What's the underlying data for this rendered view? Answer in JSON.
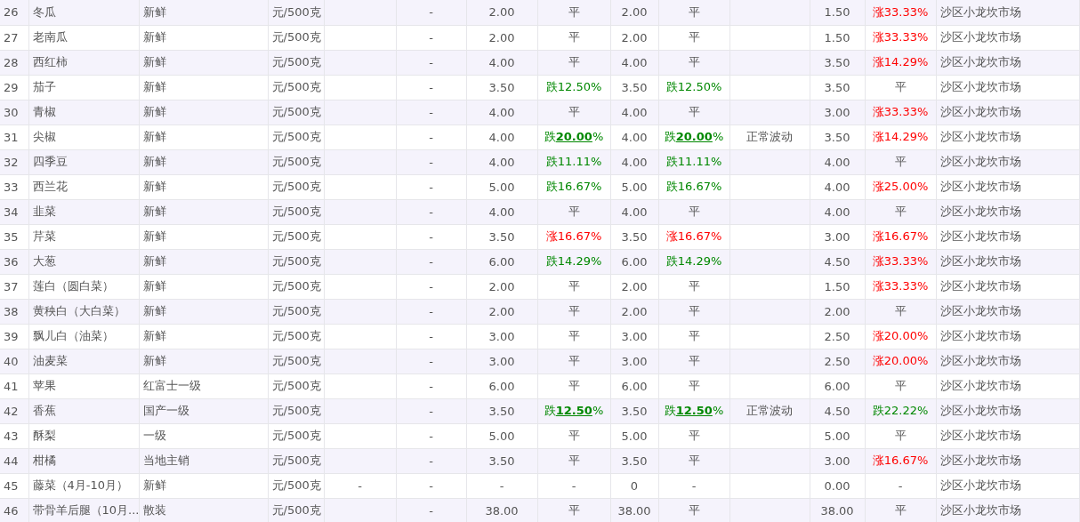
{
  "rows": [
    {
      "no": "26",
      "name": "冬瓜",
      "spec": "新鲜",
      "unit": "元/500克",
      "col5": "-",
      "price1": "2.00",
      "change1": {
        "text": "平"
      },
      "price2": "2.00",
      "change2": {
        "text": "平"
      },
      "price3": "1.50",
      "change3": {
        "text": "涨33.33%",
        "color": "#ff0000"
      },
      "market": "沙区小龙坎市场"
    },
    {
      "no": "27",
      "name": "老南瓜",
      "spec": "新鲜",
      "unit": "元/500克",
      "col5": "-",
      "price1": "2.00",
      "change1": {
        "text": "平"
      },
      "price2": "2.00",
      "change2": {
        "text": "平"
      },
      "price3": "1.50",
      "change3": {
        "text": "涨33.33%",
        "color": "#ff0000"
      },
      "market": "沙区小龙坎市场"
    },
    {
      "no": "28",
      "name": "西红柿",
      "spec": "新鲜",
      "unit": "元/500克",
      "col5": "-",
      "price1": "4.00",
      "change1": {
        "text": "平"
      },
      "price2": "4.00",
      "change2": {
        "text": "平"
      },
      "price3": "3.50",
      "change3": {
        "text": "涨14.29%",
        "color": "#ff0000"
      },
      "market": "沙区小龙坎市场"
    },
    {
      "no": "29",
      "name": "茄子",
      "spec": "新鲜",
      "unit": "元/500克",
      "col5": "-",
      "price1": "3.50",
      "change1": {
        "text": "跌12.50%",
        "color": "#008800"
      },
      "price2": "3.50",
      "change2": {
        "text": "跌12.50%",
        "color": "#008800"
      },
      "price3": "3.50",
      "change3": {
        "text": "平"
      },
      "market": "沙区小龙坎市场"
    },
    {
      "no": "30",
      "name": "青椒",
      "spec": "新鲜",
      "unit": "元/500克",
      "col5": "-",
      "price1": "4.00",
      "change1": {
        "text": "平"
      },
      "price2": "4.00",
      "change2": {
        "text": "平"
      },
      "price3": "3.00",
      "change3": {
        "text": "涨33.33%",
        "color": "#ff0000"
      },
      "market": "沙区小龙坎市场"
    },
    {
      "no": "31",
      "name": "尖椒",
      "spec": "新鲜",
      "unit": "元/500克",
      "col5": "-",
      "price1": "4.00",
      "change1": {
        "text": "跌**20.00**%",
        "color": "#008800"
      },
      "price2": "4.00",
      "change2": {
        "text": "跌**20.00**%",
        "color": "#008800"
      },
      "note": "正常波动",
      "price3": "3.50",
      "change3": {
        "text": "涨14.29%",
        "color": "#ff0000"
      },
      "market": "沙区小龙坎市场"
    },
    {
      "no": "32",
      "name": "四季豆",
      "spec": "新鲜",
      "unit": "元/500克",
      "col5": "-",
      "price1": "4.00",
      "change1": {
        "text": "跌11.11%",
        "color": "#008800"
      },
      "price2": "4.00",
      "change2": {
        "text": "跌11.11%",
        "color": "#008800"
      },
      "price3": "4.00",
      "change3": {
        "text": "平"
      },
      "market": "沙区小龙坎市场"
    },
    {
      "no": "33",
      "name": "西兰花",
      "spec": "新鲜",
      "unit": "元/500克",
      "col5": "-",
      "price1": "5.00",
      "change1": {
        "text": "跌16.67%",
        "color": "#008800"
      },
      "price2": "5.00",
      "change2": {
        "text": "跌16.67%",
        "color": "#008800"
      },
      "price3": "4.00",
      "change3": {
        "text": "涨25.00%",
        "color": "#ff0000"
      },
      "market": "沙区小龙坎市场"
    },
    {
      "no": "34",
      "name": "韭菜",
      "spec": "新鲜",
      "unit": "元/500克",
      "col5": "-",
      "price1": "4.00",
      "change1": {
        "text": "平"
      },
      "price2": "4.00",
      "change2": {
        "text": "平"
      },
      "price3": "4.00",
      "change3": {
        "text": "平"
      },
      "market": "沙区小龙坎市场"
    },
    {
      "no": "35",
      "name": "芹菜",
      "spec": "新鲜",
      "unit": "元/500克",
      "col5": "-",
      "price1": "3.50",
      "change1": {
        "text": "涨16.67%",
        "color": "#ff0000"
      },
      "price2": "3.50",
      "change2": {
        "text": "涨16.67%",
        "color": "#ff0000"
      },
      "price3": "3.00",
      "change3": {
        "text": "涨16.67%",
        "color": "#ff0000"
      },
      "market": "沙区小龙坎市场"
    },
    {
      "no": "36",
      "name": "大葱",
      "spec": "新鲜",
      "unit": "元/500克",
      "col5": "-",
      "price1": "6.00",
      "change1": {
        "text": "跌14.29%",
        "color": "#008800"
      },
      "price2": "6.00",
      "change2": {
        "text": "跌14.29%",
        "color": "#008800"
      },
      "price3": "4.50",
      "change3": {
        "text": "涨33.33%",
        "color": "#ff0000"
      },
      "market": "沙区小龙坎市场"
    },
    {
      "no": "37",
      "name": "莲白（圆白菜）",
      "spec": "新鲜",
      "unit": "元/500克",
      "col5": "-",
      "price1": "2.00",
      "change1": {
        "text": "平"
      },
      "price2": "2.00",
      "change2": {
        "text": "平"
      },
      "price3": "1.50",
      "change3": {
        "text": "涨33.33%",
        "color": "#ff0000"
      },
      "market": "沙区小龙坎市场"
    },
    {
      "no": "38",
      "name": "黄秧白（大白菜）",
      "spec": "新鲜",
      "unit": "元/500克",
      "col5": "-",
      "price1": "2.00",
      "change1": {
        "text": "平"
      },
      "price2": "2.00",
      "change2": {
        "text": "平"
      },
      "price3": "2.00",
      "change3": {
        "text": "平"
      },
      "market": "沙区小龙坎市场"
    },
    {
      "no": "39",
      "name": "飘儿白（油菜）",
      "spec": "新鲜",
      "unit": "元/500克",
      "col5": "-",
      "price1": "3.00",
      "change1": {
        "text": "平"
      },
      "price2": "3.00",
      "change2": {
        "text": "平"
      },
      "price3": "2.50",
      "change3": {
        "text": "涨20.00%",
        "color": "#ff0000"
      },
      "market": "沙区小龙坎市场"
    },
    {
      "no": "40",
      "name": "油麦菜",
      "spec": "新鲜",
      "unit": "元/500克",
      "col5": "-",
      "price1": "3.00",
      "change1": {
        "text": "平"
      },
      "price2": "3.00",
      "change2": {
        "text": "平"
      },
      "price3": "2.50",
      "change3": {
        "text": "涨20.00%",
        "color": "#ff0000"
      },
      "market": "沙区小龙坎市场"
    },
    {
      "no": "41",
      "name": "苹果",
      "spec": "红富士一级",
      "unit": "元/500克",
      "col5": "-",
      "price1": "6.00",
      "change1": {
        "text": "平"
      },
      "price2": "6.00",
      "change2": {
        "text": "平"
      },
      "price3": "6.00",
      "change3": {
        "text": "平"
      },
      "market": "沙区小龙坎市场"
    },
    {
      "no": "42",
      "name": "香蕉",
      "spec": "国产一级",
      "unit": "元/500克",
      "col5": "-",
      "price1": "3.50",
      "change1": {
        "text": "跌**12.50**%",
        "color": "#008800"
      },
      "price2": "3.50",
      "change2": {
        "text": "跌**12.50**%",
        "color": "#008800"
      },
      "note": "正常波动",
      "price3": "4.50",
      "change3": {
        "text": "跌22.22%",
        "color": "#008800"
      },
      "market": "沙区小龙坎市场"
    },
    {
      "no": "43",
      "name": "酥梨",
      "spec": "一级",
      "unit": "元/500克",
      "col5": "-",
      "price1": "5.00",
      "change1": {
        "text": "平"
      },
      "price2": "5.00",
      "change2": {
        "text": "平"
      },
      "price3": "5.00",
      "change3": {
        "text": "平"
      },
      "market": "沙区小龙坎市场"
    },
    {
      "no": "44",
      "name": "柑橘",
      "spec": "当地主销",
      "unit": "元/500克",
      "col5": "-",
      "price1": "3.50",
      "change1": {
        "text": "平"
      },
      "price2": "3.50",
      "change2": {
        "text": "平"
      },
      "price3": "3.00",
      "change3": {
        "text": "涨16.67%",
        "color": "#ff0000"
      },
      "market": "沙区小龙坎市场"
    },
    {
      "no": "45",
      "name": "藤菜（4月-10月）",
      "spec": "新鲜",
      "unit": "元/500克",
      "col4": "-",
      "col5": "-",
      "price1": "-",
      "change1": {
        "text": "-"
      },
      "price2": "0",
      "change2": {
        "text": "-"
      },
      "price3": "0.00",
      "change3": {
        "text": "-"
      },
      "market": "沙区小龙坎市场"
    },
    {
      "no": "46",
      "name": "带骨羊后腿（10月...",
      "spec": "散装",
      "unit": "元/500克",
      "col5": "-",
      "price1": "38.00",
      "change1": {
        "text": "平"
      },
      "price2": "38.00",
      "change2": {
        "text": "平"
      },
      "price3": "38.00",
      "change3": {
        "text": "平"
      },
      "market": "沙区小龙坎市场"
    }
  ]
}
